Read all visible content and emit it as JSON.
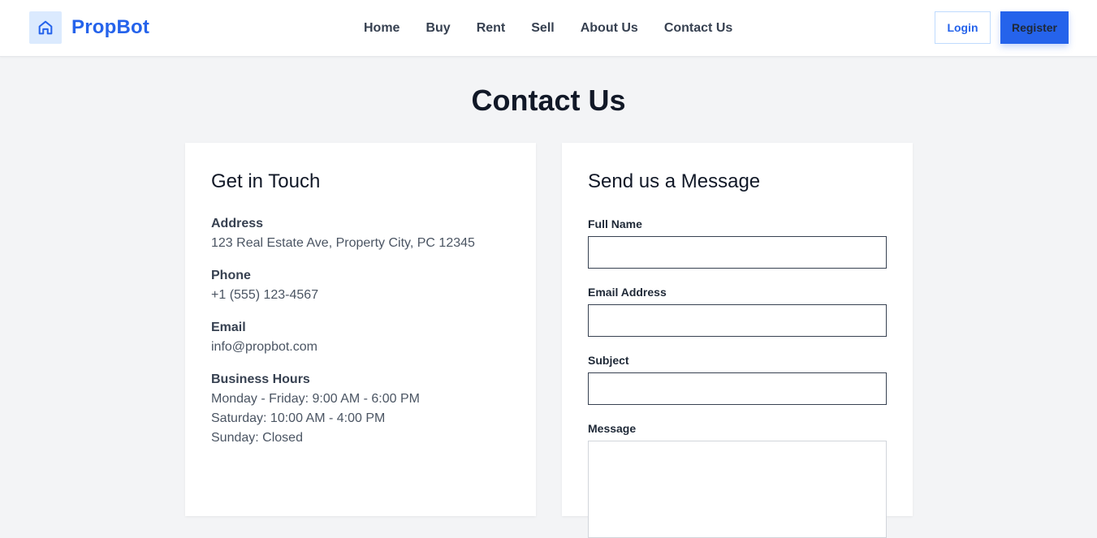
{
  "brand": {
    "name": "PropBot",
    "icon": "home-icon",
    "color": "#2563eb"
  },
  "nav": {
    "items": [
      "Home",
      "Buy",
      "Rent",
      "Sell",
      "About Us",
      "Contact Us"
    ]
  },
  "auth": {
    "login_label": "Login",
    "register_label": "Register"
  },
  "page": {
    "title": "Contact Us"
  },
  "contact_info": {
    "title": "Get in Touch",
    "address_label": "Address",
    "address_value": "123 Real Estate Ave, Property City, PC 12345",
    "phone_label": "Phone",
    "phone_value": "+1 (555) 123-4567",
    "email_label": "Email",
    "email_value": "info@propbot.com",
    "hours_label": "Business Hours",
    "hours": [
      "Monday - Friday: 9:00 AM - 6:00 PM",
      "Saturday: 10:00 AM - 4:00 PM",
      "Sunday: Closed"
    ]
  },
  "form": {
    "title": "Send us a Message",
    "full_name_label": "Full Name",
    "full_name_value": "",
    "email_label": "Email Address",
    "email_value": "",
    "subject_label": "Subject",
    "subject_value": "",
    "message_label": "Message",
    "message_value": ""
  },
  "colors": {
    "accent": "#2563eb",
    "page_background": "#f3f4f6",
    "card_background": "#ffffff"
  }
}
